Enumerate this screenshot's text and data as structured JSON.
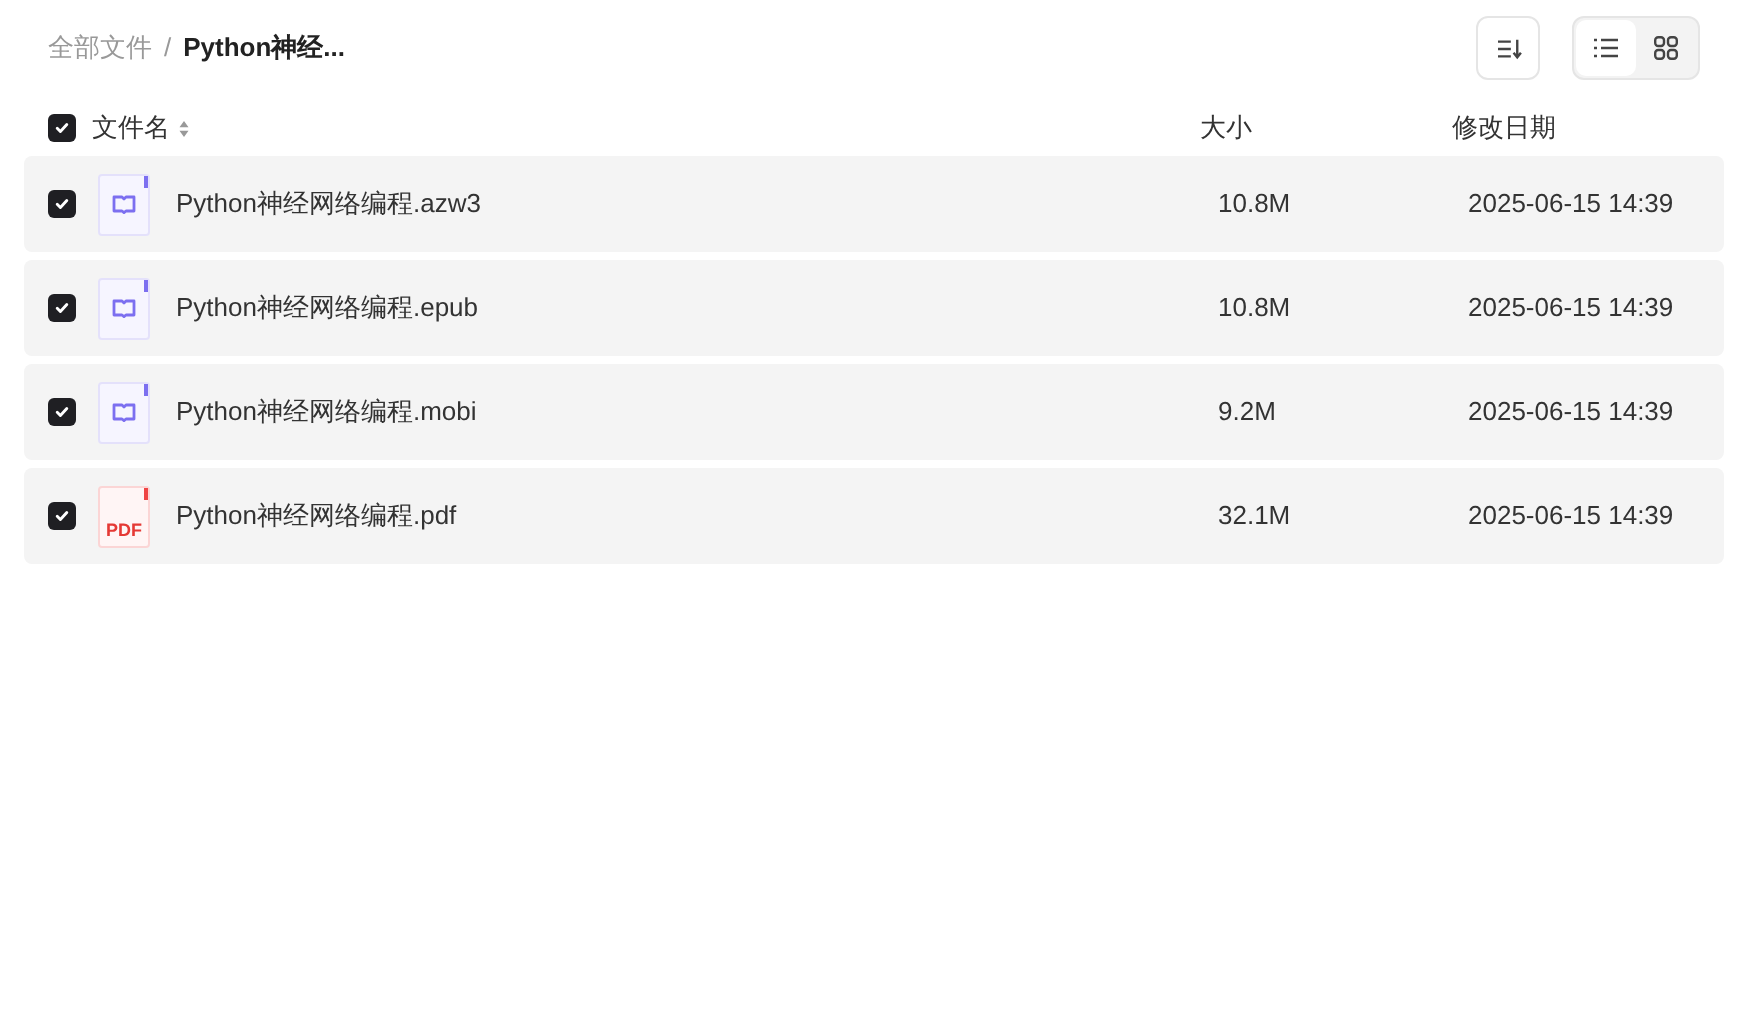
{
  "breadcrumb": [
    "全部文件",
    "/",
    "Python神经..."
  ],
  "view_modes": [
    {
      "kind": "list",
      "selected": true
    },
    {
      "kind": "grid",
      "selected": false
    }
  ],
  "header": {
    "checked": true,
    "columns": [
      "文件名",
      "大小",
      "修改日期"
    ]
  },
  "files": [
    {
      "kind": "ebook",
      "checked": true,
      "name": "Python神经网络编程.azw3",
      "size": "10.8M",
      "modified": "2025-06-15 14:39"
    },
    {
      "kind": "ebook",
      "checked": true,
      "name": "Python神经网络编程.epub",
      "size": "10.8M",
      "modified": "2025-06-15 14:39"
    },
    {
      "kind": "ebook",
      "checked": true,
      "name": "Python神经网络编程.mobi",
      "size": "9.2M",
      "modified": "2025-06-15 14:39"
    },
    {
      "kind": "pdf",
      "checked": true,
      "icon_label": "PDF",
      "name": "Python神经网络编程.pdf",
      "size": "32.1M",
      "modified": "2025-06-15 14:39"
    }
  ]
}
